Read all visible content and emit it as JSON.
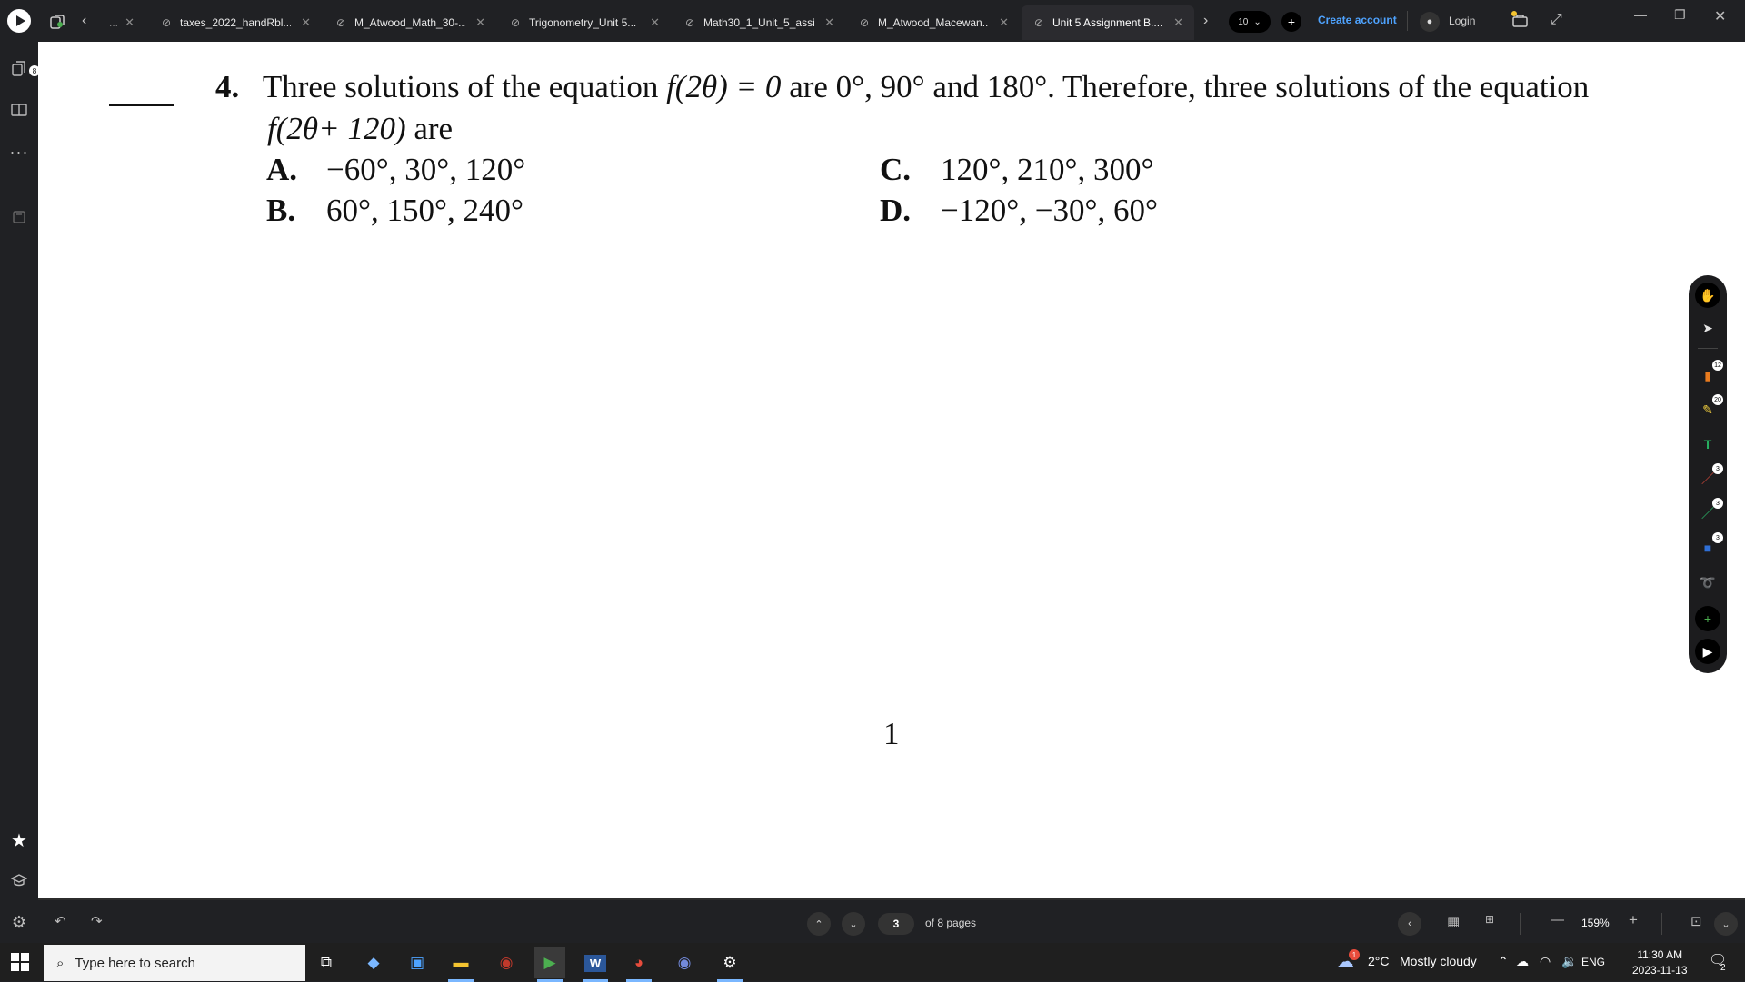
{
  "tabs": [
    {
      "label": "...",
      "active": false
    },
    {
      "label": "taxes_2022_handRbl...",
      "active": false
    },
    {
      "label": "M_Atwood_Math_30-...",
      "active": false
    },
    {
      "label": "Trigonometry_Unit 5...",
      "active": false
    },
    {
      "label": "Math30_1_Unit_5_assi...",
      "active": false
    },
    {
      "label": "M_Atwood_Macewan...",
      "active": false
    },
    {
      "label": "Unit 5 Assignment B....",
      "active": true
    }
  ],
  "header": {
    "tab_count": "10",
    "create_account": "Create account",
    "login": "Login"
  },
  "sidebar": {
    "badge": "8"
  },
  "question": {
    "number": "4.",
    "line1_text": "Three solutions of the equation",
    "line1_eq": "f(2θ) = 0",
    "line1_rest": "are 0°, 90° and 180°. Therefore, three solutions of the equation",
    "line2_eq": "f(2θ+ 120)",
    "line2_rest": "are",
    "options": [
      {
        "letter": "A.",
        "text": "−60°, 30°, 120°"
      },
      {
        "letter": "B.",
        "text": "60°, 150°, 240°"
      },
      {
        "letter": "C.",
        "text": "120°, 210°, 300°"
      },
      {
        "letter": "D.",
        "text": "−120°, −30°, 60°"
      }
    ],
    "page_footer_number": "1"
  },
  "tools": {
    "badges": {
      "stamp": "12",
      "highlighter": "20",
      "red_pen": "3",
      "green_pen": "3",
      "shape": "3"
    }
  },
  "bottom": {
    "current_page": "3",
    "page_total": "of 8 pages",
    "zoom": "159%"
  },
  "taskbar": {
    "search_placeholder": "Type here to search",
    "weather_temp": "2°C",
    "weather_desc": "Mostly cloudy",
    "weather_alert": "1",
    "language": "ENG",
    "time": "11:30 AM",
    "date": "2023-11-13",
    "notifications": "2"
  },
  "colors": {
    "accent_link": "#4ea3ff",
    "chrome_bg": "#202124",
    "page_bg": "#ffffff"
  }
}
